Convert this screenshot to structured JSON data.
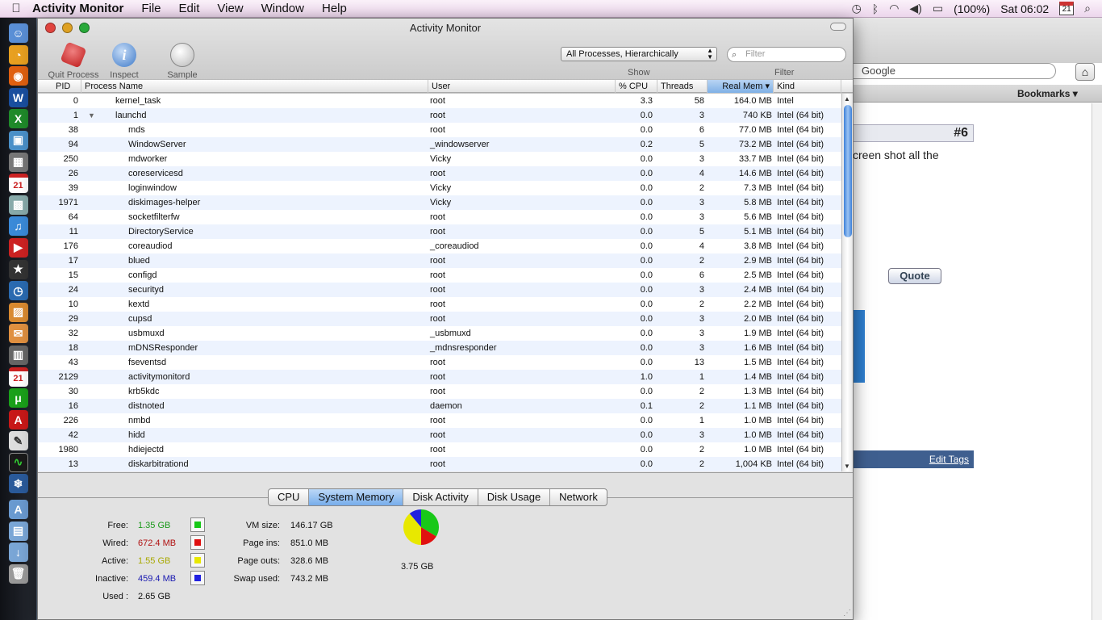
{
  "menubar": {
    "app_name": "Activity Monitor",
    "menus": [
      "File",
      "Edit",
      "View",
      "Window",
      "Help"
    ],
    "battery": "(100%)",
    "clock": "Sat 06:02",
    "calendar_day": "21"
  },
  "window": {
    "title": "Activity Monitor",
    "toolbar": {
      "quit": "Quit Process",
      "inspect": "Inspect",
      "sample": "Sample Process",
      "show_label": "Show",
      "show_value": "All Processes, Hierarchically",
      "filter_label": "Filter",
      "filter_placeholder": "Filter"
    },
    "columns": [
      "PID",
      "Process Name",
      "User",
      "% CPU",
      "Threads",
      "Real Mem ▾",
      "Kind"
    ],
    "rows": [
      {
        "pid": "0",
        "name": "kernel_task",
        "user": "root",
        "cpu": "3.3",
        "threads": "58",
        "mem": "164.0 MB",
        "kind": "Intel",
        "level": 1
      },
      {
        "pid": "1",
        "name": "launchd",
        "user": "root",
        "cpu": "0.0",
        "threads": "3",
        "mem": "740 KB",
        "kind": "Intel (64 bit)",
        "level": 1,
        "expanded": true
      },
      {
        "pid": "38",
        "name": "mds",
        "user": "root",
        "cpu": "0.0",
        "threads": "6",
        "mem": "77.0 MB",
        "kind": "Intel (64 bit)",
        "level": 2
      },
      {
        "pid": "94",
        "name": "WindowServer",
        "user": "_windowserver",
        "cpu": "0.2",
        "threads": "5",
        "mem": "73.2 MB",
        "kind": "Intel (64 bit)",
        "level": 2
      },
      {
        "pid": "250",
        "name": "mdworker",
        "user": "Vicky",
        "cpu": "0.0",
        "threads": "3",
        "mem": "33.7 MB",
        "kind": "Intel (64 bit)",
        "level": 2
      },
      {
        "pid": "26",
        "name": "coreservicesd",
        "user": "root",
        "cpu": "0.0",
        "threads": "4",
        "mem": "14.6 MB",
        "kind": "Intel (64 bit)",
        "level": 2
      },
      {
        "pid": "39",
        "name": "loginwindow",
        "user": "Vicky",
        "cpu": "0.0",
        "threads": "2",
        "mem": "7.3 MB",
        "kind": "Intel (64 bit)",
        "level": 2
      },
      {
        "pid": "1971",
        "name": "diskimages-helper",
        "user": "Vicky",
        "cpu": "0.0",
        "threads": "3",
        "mem": "5.8 MB",
        "kind": "Intel (64 bit)",
        "level": 2
      },
      {
        "pid": "64",
        "name": "socketfilterfw",
        "user": "root",
        "cpu": "0.0",
        "threads": "3",
        "mem": "5.6 MB",
        "kind": "Intel (64 bit)",
        "level": 2
      },
      {
        "pid": "11",
        "name": "DirectoryService",
        "user": "root",
        "cpu": "0.0",
        "threads": "5",
        "mem": "5.1 MB",
        "kind": "Intel (64 bit)",
        "level": 2
      },
      {
        "pid": "176",
        "name": "coreaudiod",
        "user": "_coreaudiod",
        "cpu": "0.0",
        "threads": "4",
        "mem": "3.8 MB",
        "kind": "Intel (64 bit)",
        "level": 2
      },
      {
        "pid": "17",
        "name": "blued",
        "user": "root",
        "cpu": "0.0",
        "threads": "2",
        "mem": "2.9 MB",
        "kind": "Intel (64 bit)",
        "level": 2
      },
      {
        "pid": "15",
        "name": "configd",
        "user": "root",
        "cpu": "0.0",
        "threads": "6",
        "mem": "2.5 MB",
        "kind": "Intel (64 bit)",
        "level": 2
      },
      {
        "pid": "24",
        "name": "securityd",
        "user": "root",
        "cpu": "0.0",
        "threads": "3",
        "mem": "2.4 MB",
        "kind": "Intel (64 bit)",
        "level": 2
      },
      {
        "pid": "10",
        "name": "kextd",
        "user": "root",
        "cpu": "0.0",
        "threads": "2",
        "mem": "2.2 MB",
        "kind": "Intel (64 bit)",
        "level": 2
      },
      {
        "pid": "29",
        "name": "cupsd",
        "user": "root",
        "cpu": "0.0",
        "threads": "3",
        "mem": "2.0 MB",
        "kind": "Intel (64 bit)",
        "level": 2
      },
      {
        "pid": "32",
        "name": "usbmuxd",
        "user": "_usbmuxd",
        "cpu": "0.0",
        "threads": "3",
        "mem": "1.9 MB",
        "kind": "Intel (64 bit)",
        "level": 2
      },
      {
        "pid": "18",
        "name": "mDNSResponder",
        "user": "_mdnsresponder",
        "cpu": "0.0",
        "threads": "3",
        "mem": "1.6 MB",
        "kind": "Intel (64 bit)",
        "level": 2
      },
      {
        "pid": "43",
        "name": "fseventsd",
        "user": "root",
        "cpu": "0.0",
        "threads": "13",
        "mem": "1.5 MB",
        "kind": "Intel (64 bit)",
        "level": 2
      },
      {
        "pid": "2129",
        "name": "activitymonitord",
        "user": "root",
        "cpu": "1.0",
        "threads": "1",
        "mem": "1.4 MB",
        "kind": "Intel (64 bit)",
        "level": 2
      },
      {
        "pid": "30",
        "name": "krb5kdc",
        "user": "root",
        "cpu": "0.0",
        "threads": "2",
        "mem": "1.3 MB",
        "kind": "Intel (64 bit)",
        "level": 2
      },
      {
        "pid": "16",
        "name": "distnoted",
        "user": "daemon",
        "cpu": "0.1",
        "threads": "2",
        "mem": "1.1 MB",
        "kind": "Intel (64 bit)",
        "level": 2
      },
      {
        "pid": "226",
        "name": "nmbd",
        "user": "root",
        "cpu": "0.0",
        "threads": "1",
        "mem": "1.0 MB",
        "kind": "Intel (64 bit)",
        "level": 2
      },
      {
        "pid": "42",
        "name": "hidd",
        "user": "root",
        "cpu": "0.0",
        "threads": "3",
        "mem": "1.0 MB",
        "kind": "Intel (64 bit)",
        "level": 2
      },
      {
        "pid": "1980",
        "name": "hdiejectd",
        "user": "root",
        "cpu": "0.0",
        "threads": "2",
        "mem": "1.0 MB",
        "kind": "Intel (64 bit)",
        "level": 2
      },
      {
        "pid": "13",
        "name": "diskarbitrationd",
        "user": "root",
        "cpu": "0.0",
        "threads": "2",
        "mem": "1,004 KB",
        "kind": "Intel (64 bit)",
        "level": 2
      }
    ],
    "tabs": [
      "CPU",
      "System Memory",
      "Disk Activity",
      "Disk Usage",
      "Network"
    ],
    "active_tab": "System Memory",
    "memory": {
      "free_label": "Free:",
      "free": "1.35 GB",
      "wired_label": "Wired:",
      "wired": "672.4 MB",
      "active_label": "Active:",
      "active": "1.55 GB",
      "inactive_label": "Inactive:",
      "inactive": "459.4 MB",
      "used_label": "Used :",
      "used": "2.65 GB",
      "vm_size_label": "VM size:",
      "vm_size": "146.17 GB",
      "page_ins_label": "Page ins:",
      "page_ins": "851.0 MB",
      "page_outs_label": "Page outs:",
      "page_outs": "328.6 MB",
      "swap_used_label": "Swap used:",
      "swap_used": "743.2 MB",
      "total": "3.75 GB",
      "colors": {
        "free": "#18c818",
        "wired": "#e01010",
        "active": "#e8e800",
        "inactive": "#2020e0"
      },
      "text_colors": {
        "free": "#1a9a1a",
        "wired": "#b01010",
        "active": "#a8a800",
        "inactive": "#1818b0"
      }
    }
  },
  "browser": {
    "search_text": "Google",
    "bookmarks": "Bookmarks",
    "post_number": "#6",
    "post_text": "creen shot all the",
    "quote_label": "Quote",
    "edit_tags": "Edit Tags"
  }
}
